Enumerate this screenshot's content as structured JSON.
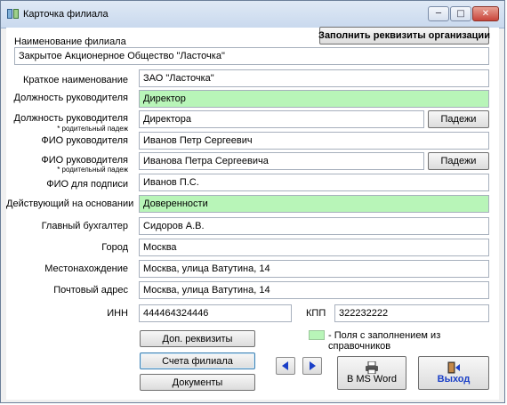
{
  "window": {
    "title": "Карточка филиала",
    "minimize": "─",
    "maximize": "□",
    "close": "✕"
  },
  "toolbar": {
    "fill_requisites": "Заполнить реквизиты организации"
  },
  "branch_name": {
    "label": "Наименование филиала",
    "value": "Закрытое Акционерное Общество \"Ласточка\""
  },
  "fields": {
    "short_name": {
      "label": "Краткое наименование",
      "value": "ЗАО \"Ласточка\""
    },
    "head_position": {
      "label": "Должность руководителя",
      "value": "Директор"
    },
    "head_position_gen": {
      "label": "Должность руководителя",
      "sublabel": "* родительный падеж",
      "value": "Директора",
      "button": "Падежи"
    },
    "head_fio": {
      "label": "ФИО руководителя",
      "value": "Иванов Петр Сергеевич"
    },
    "head_fio_gen": {
      "label": "ФИО руководителя",
      "sublabel": "* родительный падеж",
      "value": "Иванова Петра Сергеевича",
      "button": "Падежи"
    },
    "sign_fio": {
      "label": "ФИО для подписи",
      "value": "Иванов П.С."
    },
    "acting_basis": {
      "label": "Действующий на основании",
      "value": "Доверенности"
    },
    "chief_accountant": {
      "label": "Главный бухгалтер",
      "value": "Сидоров А.В."
    },
    "city": {
      "label": "Город",
      "value": "Москва"
    },
    "location": {
      "label": "Местонахождение",
      "value": "Москва, улица Ватутина, 14"
    },
    "postal_address": {
      "label": "Почтовый адрес",
      "value": "Москва, улица Ватутина, 14"
    },
    "inn": {
      "label": "ИНН",
      "value": "444464324446"
    },
    "kpp": {
      "label": "КПП",
      "value": "322232222"
    }
  },
  "buttons": {
    "extra_requisites": "Доп. реквизиты",
    "branch_accounts": "Счета филиала",
    "documents": "Документы",
    "ms_word": "В MS Word",
    "exit": "Выход"
  },
  "legend": {
    "text": "- Поля с заполнением из справочников",
    "color": "#b8f5b8"
  },
  "colors": {
    "accent_blue": "#1a3fc7",
    "highlight_green": "#b8f5b8"
  }
}
